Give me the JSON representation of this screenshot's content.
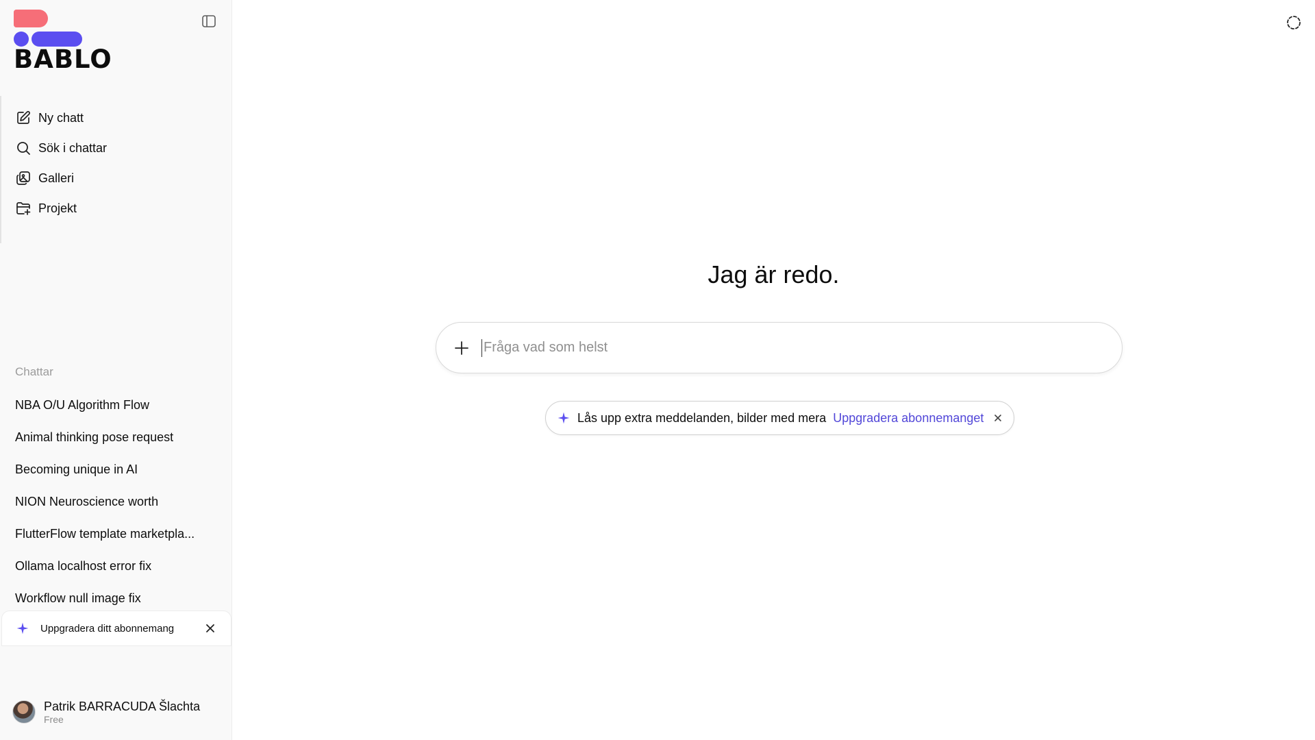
{
  "brand": {
    "name": "BABLO"
  },
  "nav": [
    {
      "label": "Ny chatt",
      "icon": "new-chat-icon"
    },
    {
      "label": "Sök i chattar",
      "icon": "search-icon"
    },
    {
      "label": "Galleri",
      "icon": "gallery-icon"
    },
    {
      "label": "Projekt",
      "icon": "project-folder-icon"
    }
  ],
  "chats": {
    "section_label": "Chattar",
    "items": [
      "NBA O/U Algorithm Flow",
      "Animal thinking pose request",
      "Becoming unique in AI",
      "NION Neuroscience worth",
      "FlutterFlow template marketpla...",
      "Ollama localhost error fix",
      "Workflow null image fix"
    ]
  },
  "sidebar_upgrade": {
    "label": "Uppgradera ditt abonnemang",
    "icon": "sparkle-icon"
  },
  "user": {
    "name": "Patrik BARRACUDA Šlachta",
    "plan": "Free"
  },
  "main": {
    "headline": "Jag är redo.",
    "composer": {
      "placeholder": "Fråga vad som helst",
      "value": ""
    },
    "promo": {
      "text": "Lås upp extra meddelanden, bilder med mera",
      "link": "Uppgradera abonnemanget"
    }
  },
  "colors": {
    "accent": "#5b4ef0",
    "brand_pink": "#f66e78",
    "link": "#5146d8",
    "sidebar_bg": "#f9f9f9"
  }
}
